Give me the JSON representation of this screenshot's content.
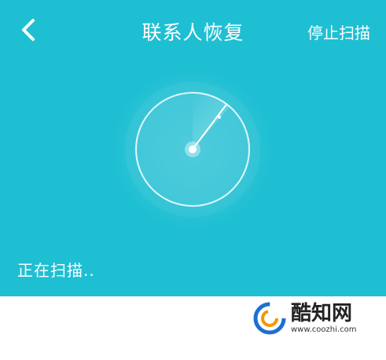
{
  "header": {
    "back_icon": "chevron-left-icon",
    "title": "联系人恢复",
    "stop_label": "停止扫描"
  },
  "scan": {
    "status_text": "正在扫描..",
    "radar_icon": "radar-icon"
  },
  "watermark": {
    "name": "酷知网",
    "url": "www.coozhi.com"
  },
  "colors": {
    "primary": "#1fbfd3",
    "text_on_primary": "#ffffff",
    "background": "#ffffff"
  }
}
